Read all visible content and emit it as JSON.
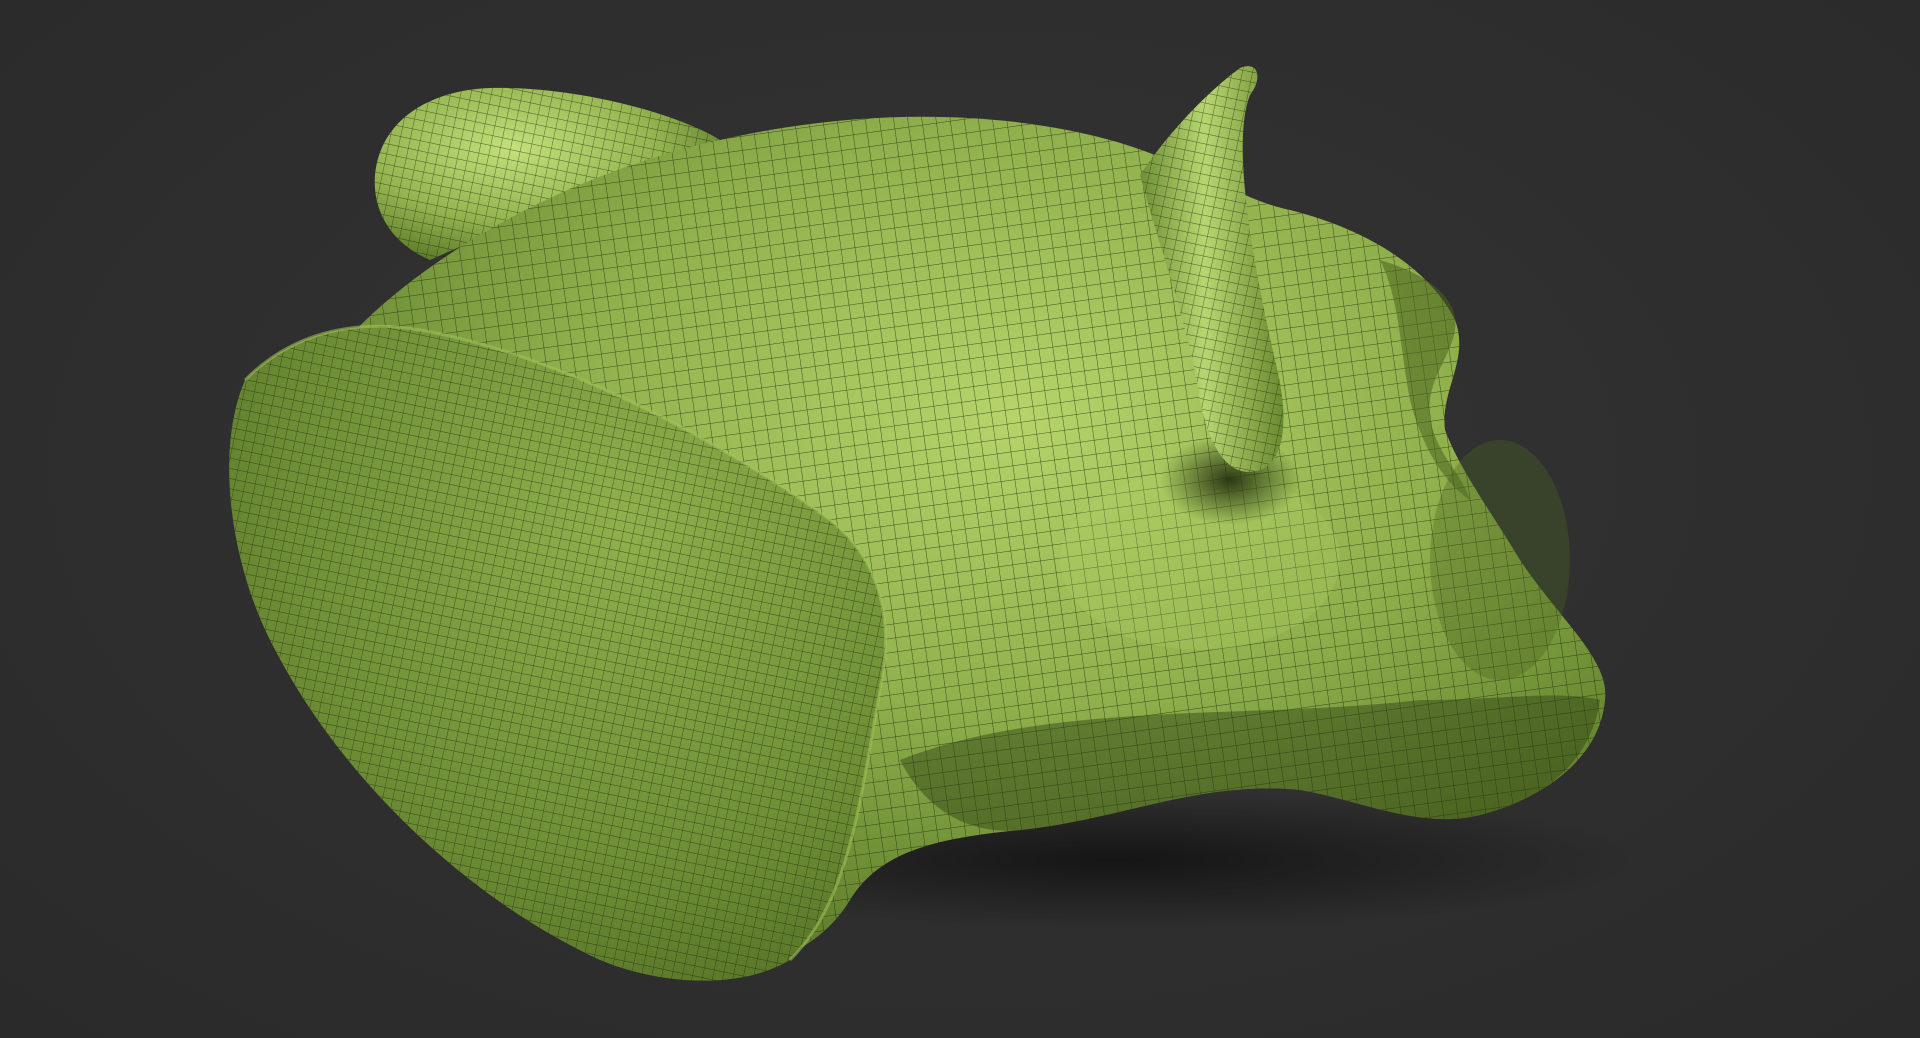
{
  "viewport": {
    "background_color": "#2f2f2f"
  },
  "model": {
    "material_color": "#8fb04c",
    "highlight_color": "#c3e07a",
    "shadow_color": "#3f5a1c",
    "wire_color": "#1f2a10"
  }
}
